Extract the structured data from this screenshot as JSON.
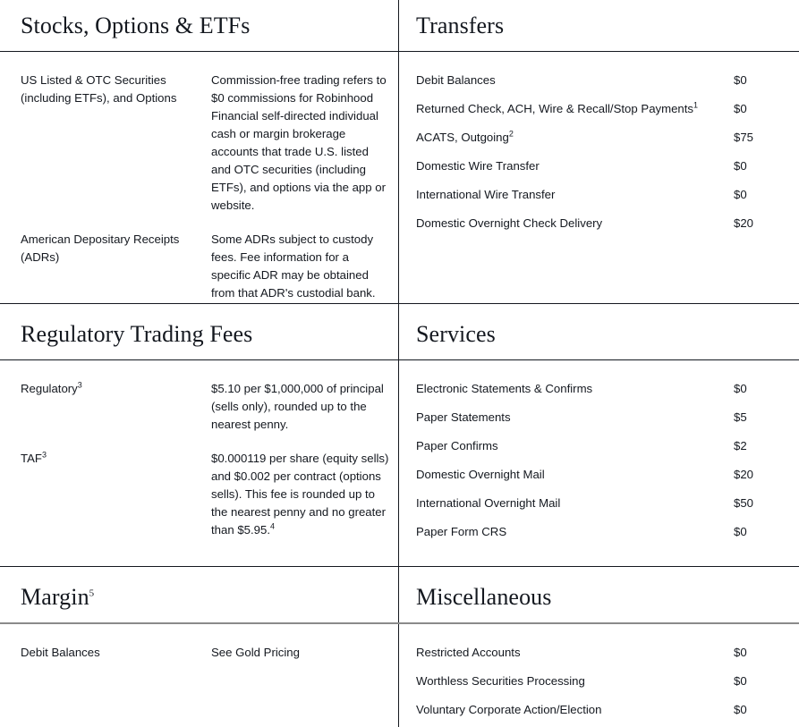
{
  "sections": [
    {
      "id": "stocks-options-etfs",
      "title": "Stocks, Options & ETFs",
      "layout": "definitions",
      "rows": [
        {
          "term": "US Listed & OTC Securities (including ETFs), and Options",
          "desc": "Commission-free trading refers to $0 commissions for Robinhood Financial self-directed individual cash or margin brokerage accounts that trade U.S. listed and OTC securities (including ETFs), and options via the app or website."
        },
        {
          "term": "American Depositary Receipts (ADRs)",
          "desc": "Some ADRs subject to custody fees. Fee information for a specific ADR may be obtained from that ADR's custodial bank."
        }
      ]
    },
    {
      "id": "transfers",
      "title": "Transfers",
      "layout": "fees",
      "rows": [
        {
          "label": "Debit Balances",
          "sup": "",
          "price": "$0"
        },
        {
          "label": "Returned Check, ACH, Wire & Recall/Stop Payments",
          "sup": "1",
          "price": "$0"
        },
        {
          "label": "ACATS, Outgoing",
          "sup": "2",
          "price": "$75"
        },
        {
          "label": "Domestic Wire Transfer",
          "sup": "",
          "price": "$0"
        },
        {
          "label": "International Wire Transfer",
          "sup": "",
          "price": "$0"
        },
        {
          "label": "Domestic Overnight Check Delivery",
          "sup": "",
          "price": "$20"
        }
      ]
    },
    {
      "id": "regulatory-trading-fees",
      "title": "Regulatory Trading Fees",
      "layout": "definitions",
      "rows": [
        {
          "term": "Regulatory",
          "term_sup": "3",
          "desc": "$5.10 per $1,000,000 of principal (sells only), rounded up to the nearest penny."
        },
        {
          "term": "TAF",
          "term_sup": "3",
          "desc": "$0.000119 per share (equity sells) and $0.002 per contract (options sells). This fee is rounded up to the nearest penny and no greater than $5.95.",
          "desc_sup": "4"
        }
      ]
    },
    {
      "id": "services",
      "title": "Services",
      "layout": "fees",
      "rows": [
        {
          "label": "Electronic Statements & Confirms",
          "sup": "",
          "price": "$0"
        },
        {
          "label": "Paper Statements",
          "sup": "",
          "price": "$5"
        },
        {
          "label": "Paper Confirms",
          "sup": "",
          "price": "$2"
        },
        {
          "label": "Domestic Overnight Mail",
          "sup": "",
          "price": "$20"
        },
        {
          "label": "International Overnight Mail",
          "sup": "",
          "price": "$50"
        },
        {
          "label": "Paper Form CRS",
          "sup": "",
          "price": "$0"
        }
      ]
    },
    {
      "id": "margin",
      "title": "Margin",
      "title_sup": "5",
      "layout": "definitions",
      "rows": [
        {
          "term": "Debit Balances",
          "desc": "See Gold Pricing"
        }
      ]
    },
    {
      "id": "miscellaneous",
      "title": "Miscellaneous",
      "layout": "fees",
      "rows": [
        {
          "label": "Restricted Accounts",
          "sup": "",
          "price": "$0"
        },
        {
          "label": "Worthless Securities Processing",
          "sup": "",
          "price": "$0"
        },
        {
          "label": "Voluntary Corporate Action/Election",
          "sup": "",
          "price": "$0"
        }
      ]
    }
  ],
  "colors": {
    "text": "#14181f",
    "rule": "#14181f",
    "rule_gray": "#8a8a8a",
    "background": "#ffffff"
  }
}
